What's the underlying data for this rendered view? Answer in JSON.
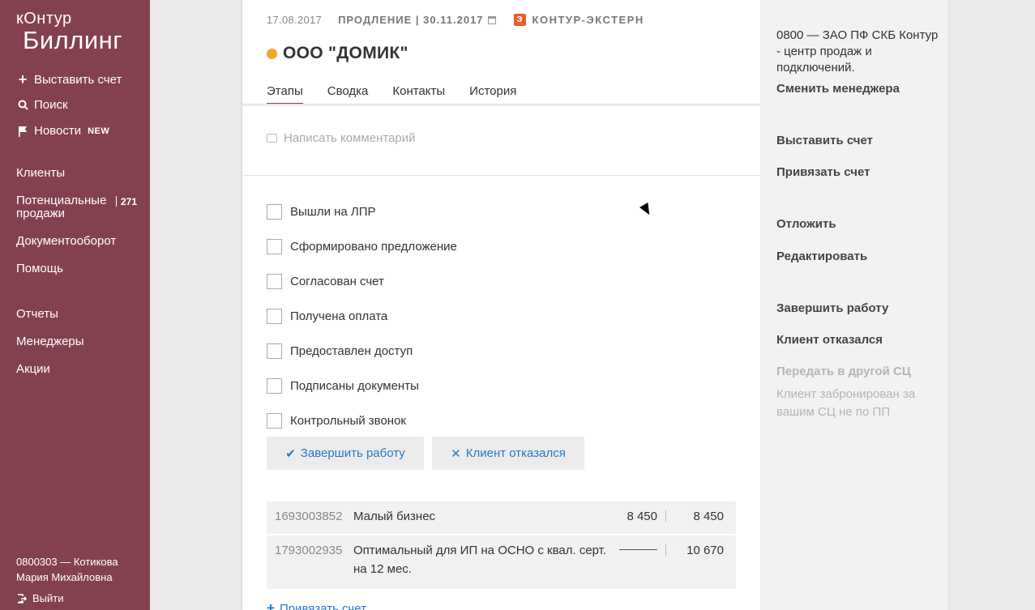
{
  "sidebar": {
    "logo_top": "кОнтур",
    "logo_bottom": "Биллинг",
    "create_invoice": "Выставить счет",
    "search": "Поиск",
    "news": "Новости",
    "news_badge": "NEW",
    "clients": "Клиенты",
    "potential": "Потенциальные продажи",
    "potential_count": "271",
    "docflow": "Документооборот",
    "help": "Помощь",
    "reports": "Отчеты",
    "managers": "Менеджеры",
    "promotions": "Акции",
    "user_line1": "0800303 — Котикова",
    "user_line2": "Мария Михайловна",
    "logout": "Выйти"
  },
  "card": {
    "date": "17.08.2017",
    "renewal": "ПРОДЛЕНИЕ | 30.11.2017",
    "product_icon": "Э",
    "product": "КОНТУР-ЭКСТЕРН",
    "client_name": "ООО \"ДОМИК\"",
    "status_color": "#f5a623",
    "tabs": [
      "Этапы",
      "Сводка",
      "Контакты",
      "История"
    ],
    "comment_placeholder": "Написать комментарий",
    "checklist": [
      "Вышли на ЛПР",
      "Сформировано предложение",
      "Согласован счет",
      "Получена оплата",
      "Предоставлен доступ",
      "Подписаны документы",
      "Контрольный звонок"
    ],
    "finish_button": "Завершить работу",
    "reject_button": "Клиент отказался",
    "bills": [
      {
        "id": "1693003852",
        "name": "Малый бизнес",
        "sum": "8 450",
        "total": "8 450"
      },
      {
        "id": "1793002935",
        "name": "Оптимальный для ИП на ОСНО с квал. серт. на 12 мес.",
        "sum": "",
        "total": "10 670"
      }
    ],
    "bind_invoice": "Привязать счет"
  },
  "right": {
    "manager_info": "0800 — ЗАО ПФ СКБ Контур - центр продаж и подключений.",
    "change_manager": "Сменить менеджера",
    "create_invoice": "Выставить счет",
    "bind_invoice": "Привязать счет",
    "postpone": "Отложить",
    "edit": "Редактировать",
    "finish": "Завершить работу",
    "rejected": "Клиент отказался",
    "transfer": "Передать в другой СЦ",
    "transfer_note": "Клиент забронирован за вашим СЦ не по ПП"
  }
}
